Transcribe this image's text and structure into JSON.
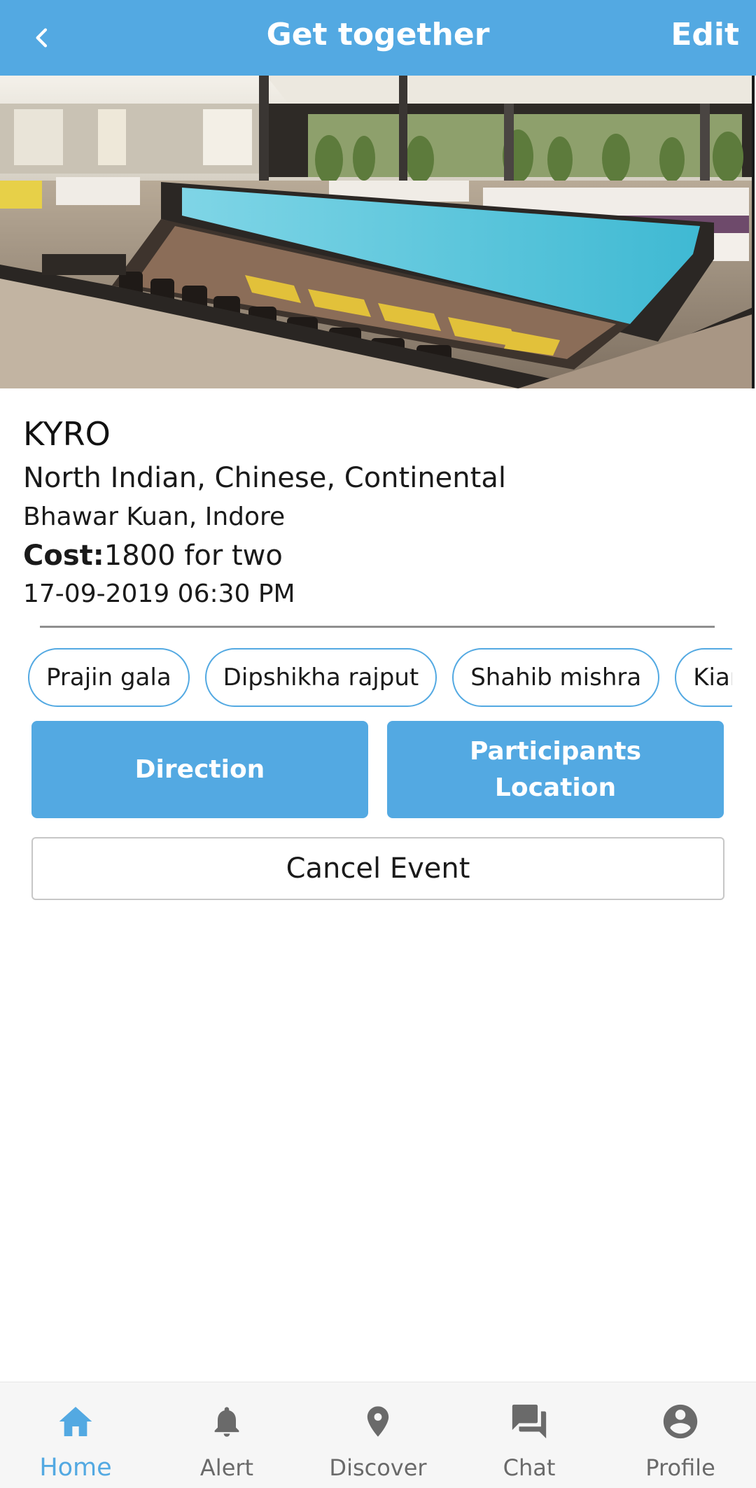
{
  "header": {
    "back_icon": "chevron-left-icon",
    "title": "Get together",
    "edit_label": "Edit",
    "background_color": "#53a9e2"
  },
  "event": {
    "venue_name": "KYRO",
    "cuisines": "North Indian, Chinese, Continental",
    "location": "Bhawar Kuan, Indore",
    "cost_label": "Cost:",
    "cost_value": "1800 for two",
    "datetime": "17-09-2019 06:30 PM"
  },
  "participants": [
    {
      "name": "Prajin gala"
    },
    {
      "name": "Dipshikha rajput"
    },
    {
      "name": "Shahib mishra"
    },
    {
      "name": "Kiar"
    }
  ],
  "actions": {
    "direction_label": "Direction",
    "participants_location_label": "Participants Location",
    "cancel_label": "Cancel Event"
  },
  "nav": {
    "items": [
      {
        "label": "Home",
        "icon": "home-icon",
        "active": true
      },
      {
        "label": "Alert",
        "icon": "bell-icon",
        "active": false
      },
      {
        "label": "Discover",
        "icon": "location-pin-icon",
        "active": false
      },
      {
        "label": "Chat",
        "icon": "chat-bubbles-icon",
        "active": false
      },
      {
        "label": "Profile",
        "icon": "account-circle-icon",
        "active": false
      }
    ]
  },
  "colors": {
    "accent": "#53a9e2",
    "nav_inactive": "#6a6a6a",
    "nav_background": "#f6f6f6"
  }
}
